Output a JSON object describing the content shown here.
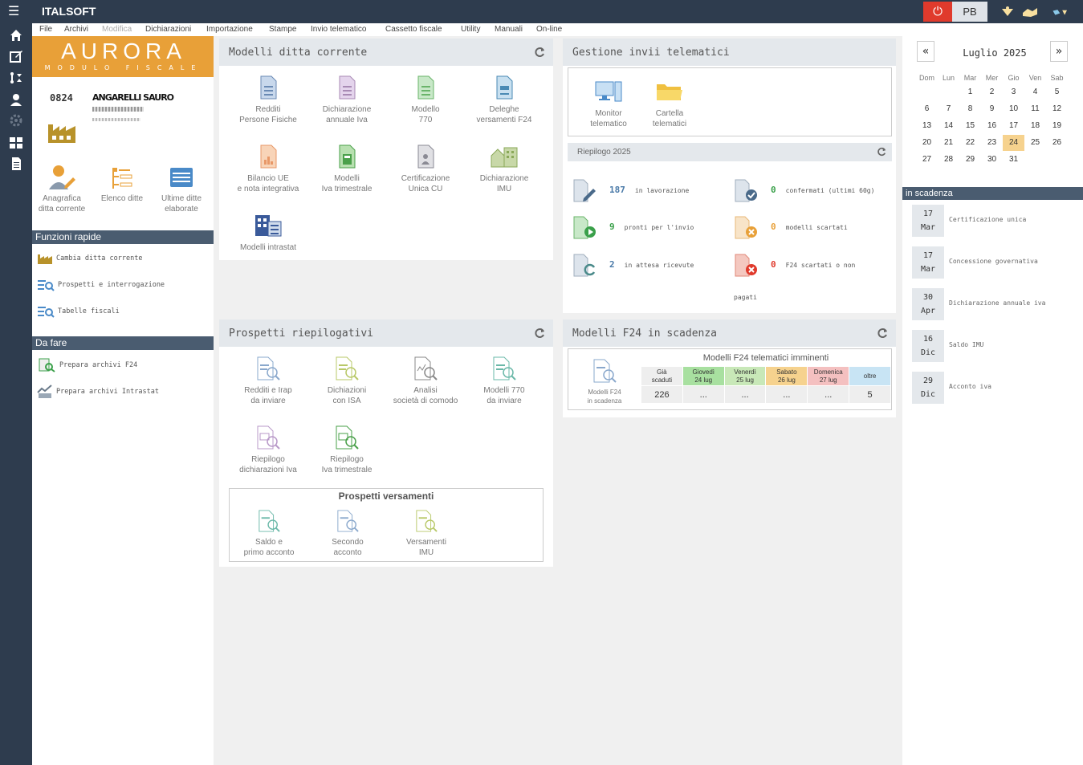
{
  "topbar": {
    "brand_bold": "ITALSOFT",
    "brand_italic": "",
    "user_initials": "PB"
  },
  "menu": [
    "File",
    "Archivi",
    "Modifica",
    "Dichiarazioni",
    "Importazione",
    "Stampe",
    "Invio telematico",
    "Cassetto fiscale",
    "Utility",
    "Manuali",
    "On-line"
  ],
  "logo": {
    "title": "AURORA",
    "subtitle": "MODULO FISCALE"
  },
  "ditta": {
    "code": "0824",
    "name": "ANGARELLI SAURO"
  },
  "left_tiles": [
    {
      "l1": "Anagrafica",
      "l2": "ditta corrente"
    },
    {
      "l1": "Elenco ditte",
      "l2": ""
    },
    {
      "l1": "Ultime ditte",
      "l2": "elaborate"
    }
  ],
  "funzioni": {
    "title": "Funzioni rapide",
    "items": [
      "Cambia ditta corrente",
      "Prospetti e interrogazione",
      "Tabelle fiscali"
    ]
  },
  "dafare": {
    "title": "Da fare",
    "items": [
      "Prepara archivi F24",
      "Prepara archivi Intrastat"
    ]
  },
  "modelli": {
    "title": "Modelli ditta corrente",
    "items": [
      {
        "l1": "Redditi",
        "l2": "Persone Fisiche"
      },
      {
        "l1": "Dichiarazione",
        "l2": "annuale Iva"
      },
      {
        "l1": "Modello",
        "l2": "770"
      },
      {
        "l1": "Deleghe",
        "l2": "versamenti F24"
      },
      {
        "l1": "Bilancio UE",
        "l2": "e nota integrativa"
      },
      {
        "l1": "Modelli",
        "l2": "Iva trimestrale"
      },
      {
        "l1": "Certificazione",
        "l2": "Unica CU"
      },
      {
        "l1": "Dichiarazione",
        "l2": "IMU"
      },
      {
        "l1": "Modelli intrastat",
        "l2": ""
      }
    ]
  },
  "prospetti": {
    "title": "Prospetti riepilogativi",
    "items": [
      {
        "l1": "Redditi e Irap",
        "l2": "da inviare"
      },
      {
        "l1": "Dichiazioni",
        "l2": "con ISA"
      },
      {
        "l1": "Analisi",
        "l2": "società di comodo"
      },
      {
        "l1": "Modelli 770",
        "l2": "da inviare"
      },
      {
        "l1": "Riepilogo",
        "l2": "dichiarazioni Iva"
      },
      {
        "l1": "Riepilogo",
        "l2": "Iva trimestrale"
      }
    ],
    "versamenti_title": "Prospetti versamenti",
    "versamenti": [
      {
        "l1": "Saldo e",
        "l2": "primo acconto"
      },
      {
        "l1": "Secondo",
        "l2": "acconto"
      },
      {
        "l1": "Versamenti",
        "l2": "IMU"
      }
    ]
  },
  "gestione": {
    "title": "Gestione invii telematici",
    "items": [
      {
        "l1": "Monitor",
        "l2": "telematico"
      },
      {
        "l1": "Cartella",
        "l2": "telematici"
      }
    ],
    "riepilogo_title": "Riepilogo 2025",
    "stats": [
      {
        "n": "187",
        "label": "in lavorazione",
        "color": "#4a7aa8"
      },
      {
        "n": "0",
        "label": "confermati (ultimi 60g)",
        "color": "#3aa04a"
      },
      {
        "n": "9",
        "label": "pronti per l'invio",
        "color": "#3aa04a"
      },
      {
        "n": "0",
        "label": "modelli scartati",
        "color": "#e8a038"
      },
      {
        "n": "2",
        "label": "in attesa ricevute",
        "color": "#4a7aa8"
      },
      {
        "n": "0",
        "label": "F24 scartati o non",
        "color": "#e03a2c"
      }
    ],
    "stat_extra": "pagati"
  },
  "f24": {
    "title": "Modelli F24 in scadenza",
    "table_title": "Modelli F24 telematici imminenti",
    "icon_l1": "Modelli F24",
    "icon_l2": "in scadenza",
    "cols": [
      {
        "h1": "Già",
        "h2": "scaduti",
        "v": "226",
        "bg": "#eeeeee"
      },
      {
        "h1": "Giovedì",
        "h2": "24 lug",
        "v": "...",
        "bg": "#a8e0a0"
      },
      {
        "h1": "Venerdì",
        "h2": "25 lug",
        "v": "...",
        "bg": "#c8e8b8"
      },
      {
        "h1": "Sabato",
        "h2": "26 lug",
        "v": "...",
        "bg": "#f6d28e"
      },
      {
        "h1": "Domenica",
        "h2": "27 lug",
        "v": "...",
        "bg": "#f4c0c0"
      },
      {
        "h1": "oltre",
        "h2": "",
        "v": "5",
        "bg": "#c8e4f4"
      }
    ]
  },
  "calendar": {
    "title": "Luglio 2025",
    "prev": "«",
    "next": "»",
    "days": [
      "Dom",
      "Lun",
      "Mar",
      "Mer",
      "Gio",
      "Ven",
      "Sab"
    ],
    "weeks": [
      [
        "",
        "",
        "1",
        "2",
        "3",
        "4",
        "5"
      ],
      [
        "6",
        "7",
        "8",
        "9",
        "10",
        "11",
        "12"
      ],
      [
        "13",
        "14",
        "15",
        "16",
        "17",
        "18",
        "19"
      ],
      [
        "20",
        "21",
        "22",
        "23",
        "24",
        "25",
        "26"
      ],
      [
        "27",
        "28",
        "29",
        "30",
        "31",
        "",
        ""
      ]
    ],
    "today": "24"
  },
  "scadenze": {
    "title": "in scadenza",
    "items": [
      {
        "d": "17",
        "m": "Mar",
        "label": "Certificazione unica"
      },
      {
        "d": "17",
        "m": "Mar",
        "label": "Concessione governativa"
      },
      {
        "d": "30",
        "m": "Apr",
        "label": "Dichiarazione annuale iva"
      },
      {
        "d": "16",
        "m": "Dic",
        "label": "Saldo IMU"
      },
      {
        "d": "29",
        "m": "Dic",
        "label": "Acconto iva"
      }
    ]
  }
}
